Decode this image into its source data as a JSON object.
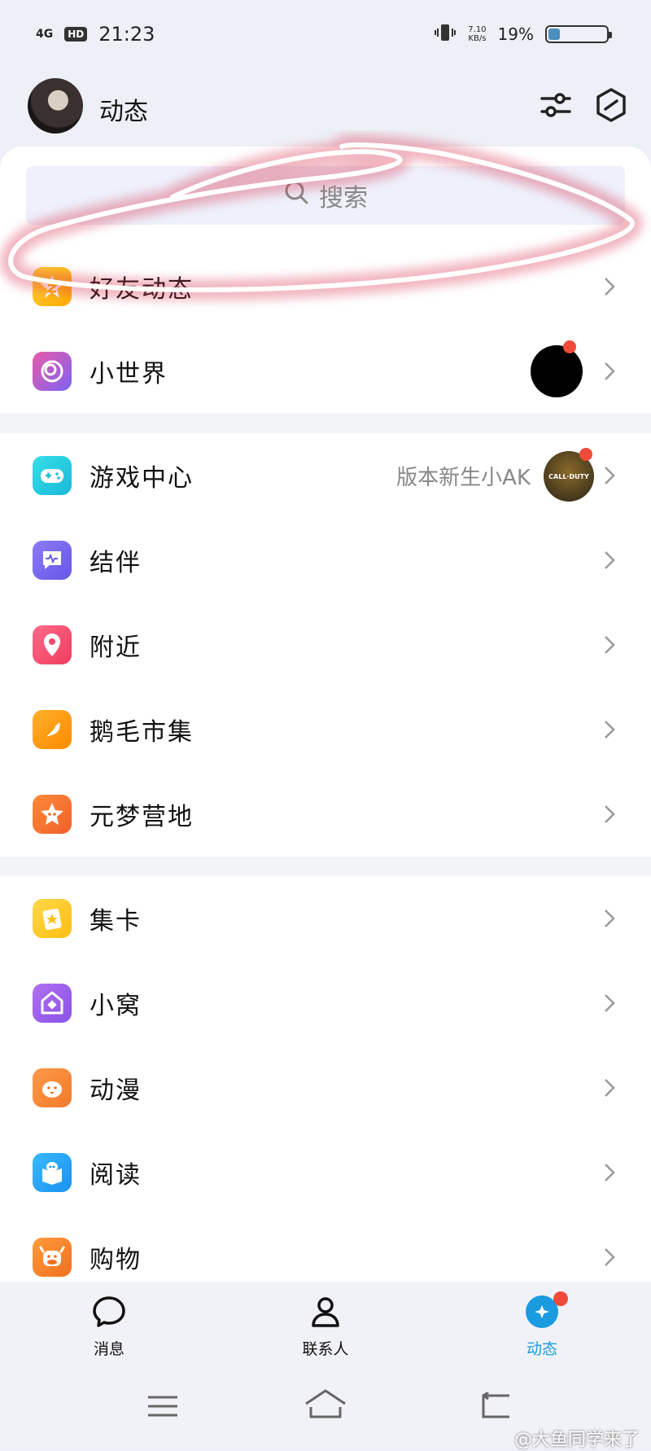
{
  "status_bar": {
    "network": "4G",
    "hd": "HD",
    "time": "21:23",
    "speed_value": "7.10",
    "speed_unit": "KB/s",
    "battery_percent": "19%",
    "battery_level": 0.19
  },
  "header": {
    "title": "动态"
  },
  "search": {
    "placeholder": "搜索"
  },
  "groups": [
    {
      "items": [
        {
          "label": "好友动态"
        },
        {
          "label": "小世界"
        }
      ]
    },
    {
      "items": [
        {
          "label": "游戏中心",
          "subtitle": "版本新生小AK",
          "thumb_text": "CALL·DUTY"
        },
        {
          "label": "结伴"
        },
        {
          "label": "附近"
        },
        {
          "label": "鹅毛市集"
        },
        {
          "label": "元梦营地"
        }
      ]
    },
    {
      "items": [
        {
          "label": "集卡"
        },
        {
          "label": "小窝"
        },
        {
          "label": "动漫"
        },
        {
          "label": "阅读"
        },
        {
          "label": "购物"
        }
      ]
    }
  ],
  "tabs": [
    {
      "label": "消息"
    },
    {
      "label": "联系人"
    },
    {
      "label": "动态"
    }
  ],
  "watermark": "@大鱼同学来了",
  "colors": {
    "accent": "#1a9be0",
    "badge": "#f04a3a",
    "annotation": "#d9334d"
  }
}
